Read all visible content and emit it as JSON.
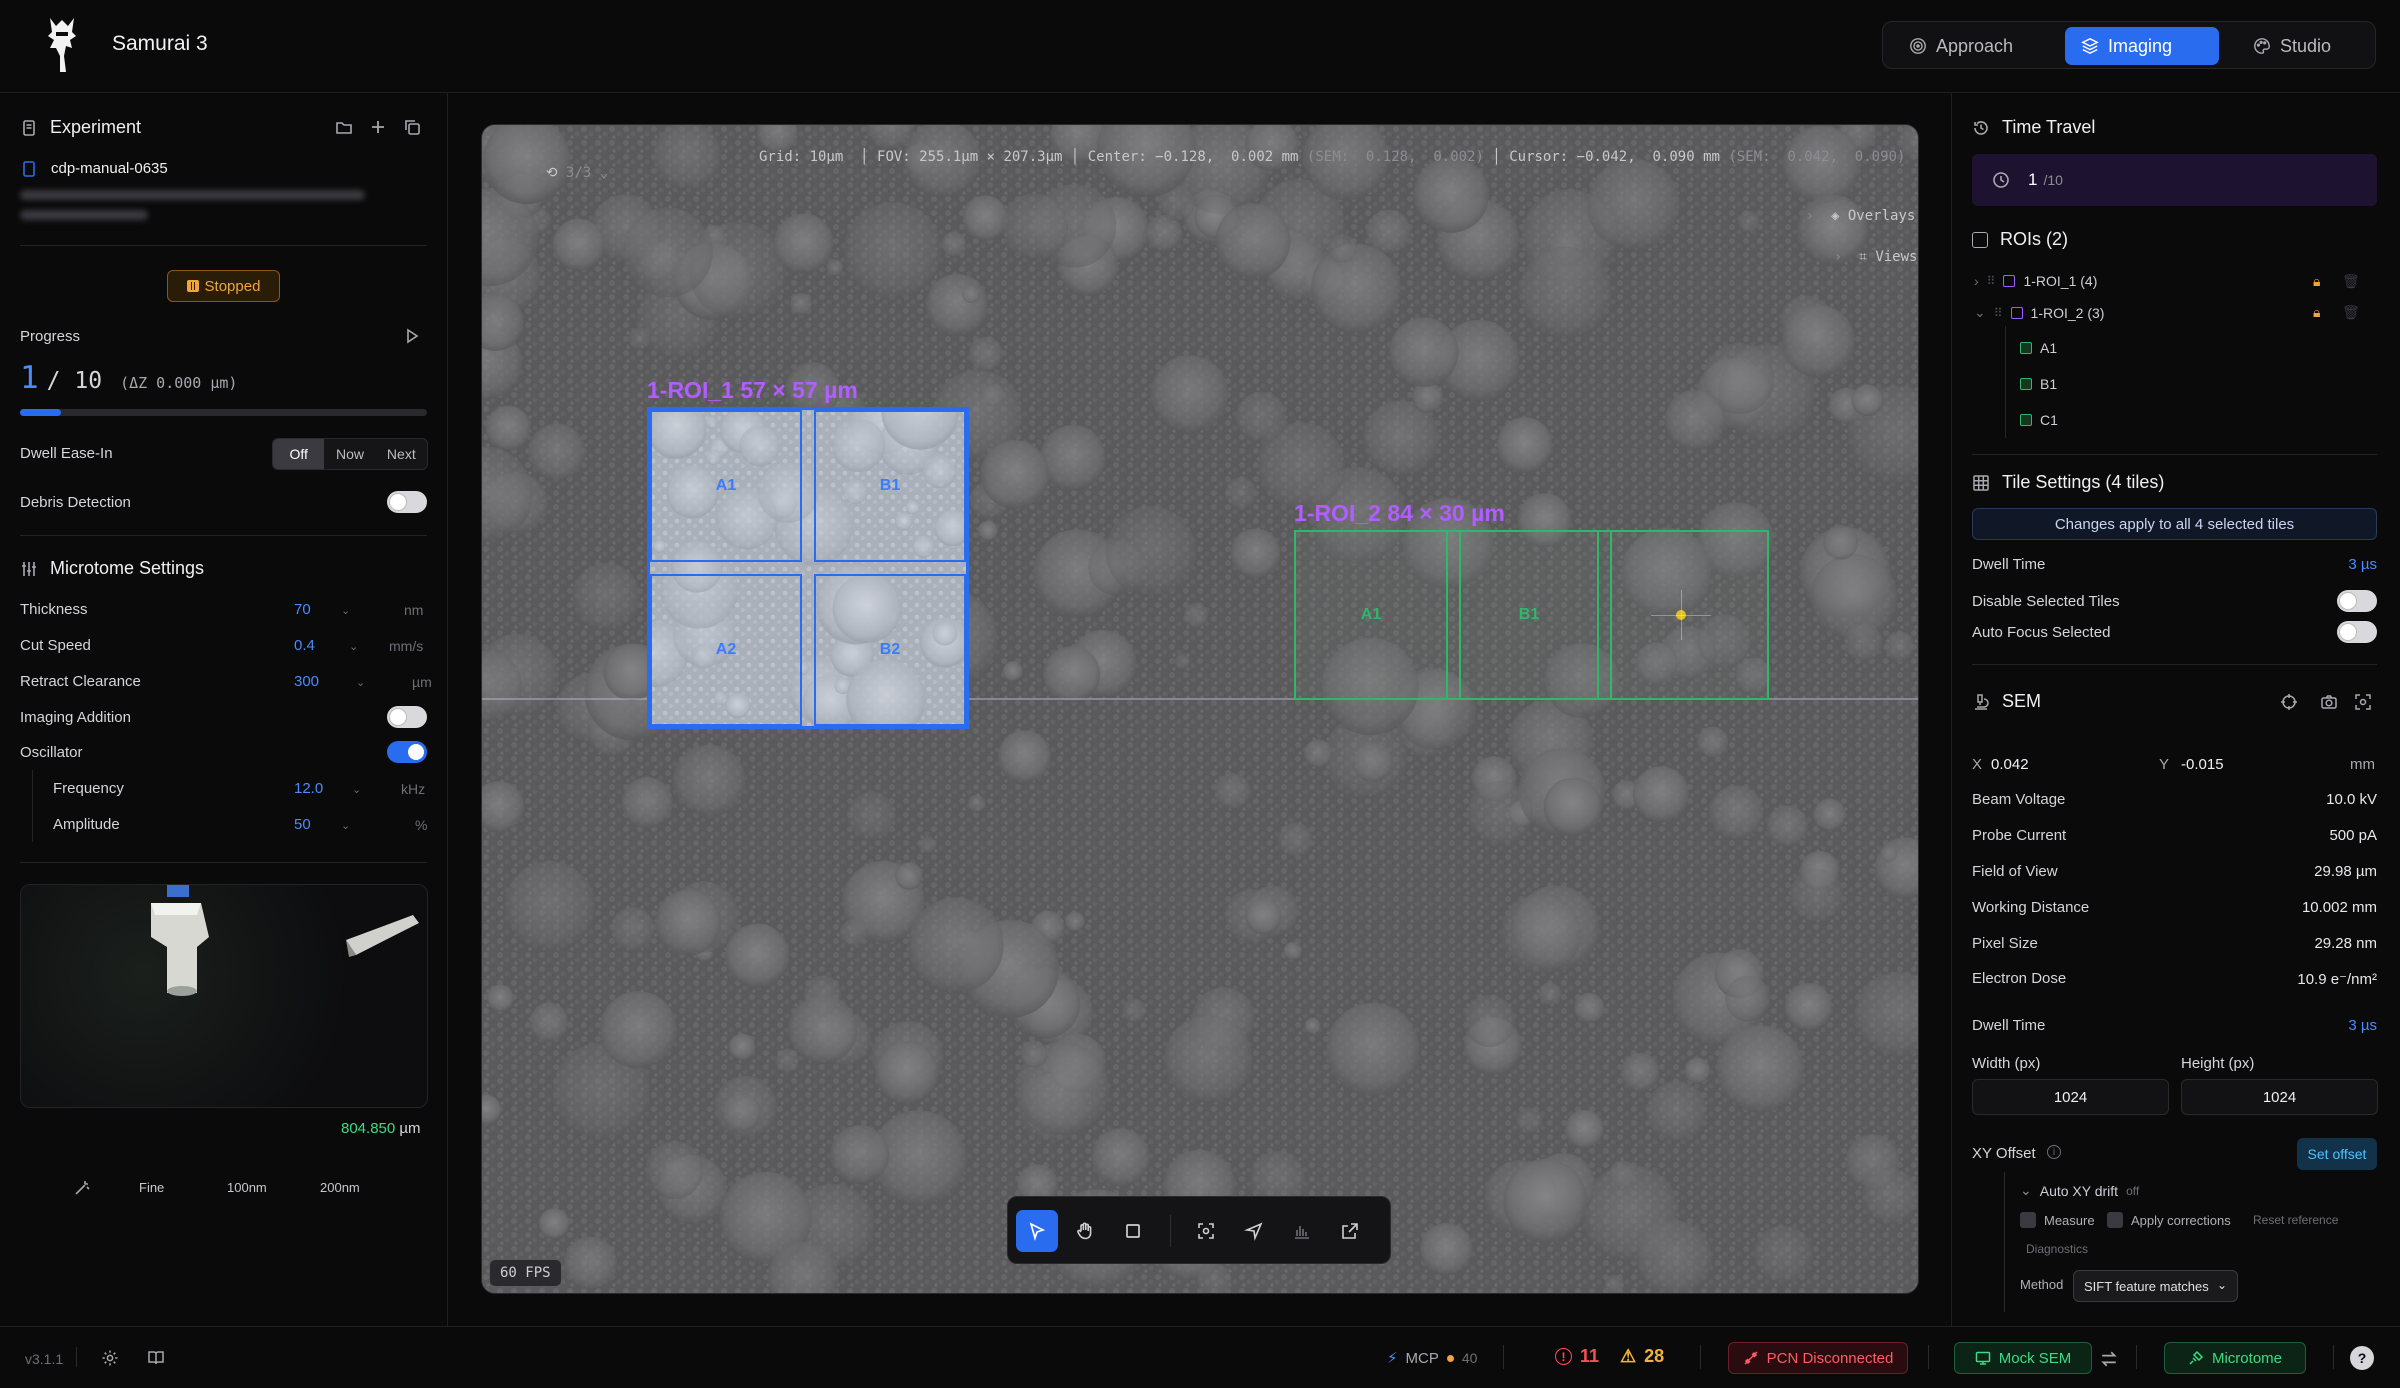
{
  "app": {
    "title": "Samurai 3"
  },
  "modes": [
    {
      "label": "Approach",
      "icon": "target-icon",
      "active": false
    },
    {
      "label": "Imaging",
      "icon": "layers-icon",
      "active": true
    },
    {
      "label": "Studio",
      "icon": "palette-icon",
      "active": false
    }
  ],
  "experiment": {
    "title": "Experiment",
    "name": "cdp-manual-0635",
    "status": "Stopped",
    "progress_label": "Progress",
    "progress_current": "1",
    "progress_total": "/ 10",
    "progress_delta": "(ΔZ 0.000 µm)",
    "progress_fraction": 0.1,
    "dwell_ease_label": "Dwell Ease-In",
    "dwell_ease_options": [
      "Off",
      "Now",
      "Next"
    ],
    "dwell_ease_selected": "Off",
    "debris_label": "Debris Detection",
    "debris_on": false
  },
  "microtome": {
    "title": "Microtome Settings",
    "thickness": {
      "label": "Thickness",
      "value": "70",
      "unit": "nm"
    },
    "cut_speed": {
      "label": "Cut Speed",
      "value": "0.4",
      "unit": "mm/s"
    },
    "retract": {
      "label": "Retract Clearance",
      "value": "300",
      "unit": "µm"
    },
    "imaging_addition": {
      "label": "Imaging Addition",
      "on": false
    },
    "oscillator": {
      "label": "Oscillator",
      "on": true
    },
    "frequency": {
      "label": "Frequency",
      "value": "12.0",
      "unit": "kHz"
    },
    "amplitude": {
      "label": "Amplitude",
      "value": "50",
      "unit": "%"
    },
    "position": "804.850",
    "position_unit": "µm",
    "step_options": [
      "Fine",
      "100nm",
      "200nm"
    ]
  },
  "viewer": {
    "counter": "3/3",
    "grid": "Grid: 10µm",
    "fov": "FOV: 255.1µm × 207.3µm",
    "center": "Center: −0.128,  0.002 mm",
    "center_sem": "(SEM:  0.128,  0.002)",
    "cursor": "Cursor: −0.042,  0.090 mm",
    "cursor_sem": "(SEM:  0.042,  0.090)",
    "overlays": "Overlays",
    "views": "Views",
    "fps": "60 FPS",
    "roi1_label": "1-ROI_1 57 × 57 µm",
    "roi2_label": "1-ROI_2 84 × 30 µm",
    "roi1_tiles": [
      "A1",
      "B1",
      "A2",
      "B2"
    ],
    "roi2_tiles": [
      "A1",
      "B1"
    ],
    "accent_blue": "#2a6cf0",
    "accent_green": "#2fb86a",
    "accent_purple": "#b35cff"
  },
  "toolbar": {
    "tools": [
      "select-pointer-icon",
      "hand-pan-icon",
      "rectangle-icon",
      "focus-icon",
      "navigate-icon",
      "histogram-icon",
      "external-link-icon"
    ]
  },
  "time_travel": {
    "title": "Time Travel",
    "current": "1",
    "total": "/10"
  },
  "rois": {
    "title": "ROIs (2)",
    "items": [
      {
        "label": "1-ROI_1 (4)",
        "expanded": false
      },
      {
        "label": "1-ROI_2 (3)",
        "expanded": true
      }
    ],
    "children": [
      "A1",
      "B1",
      "C1"
    ]
  },
  "tile_settings": {
    "title": "Tile Settings (4 tiles)",
    "info": "Changes apply to all 4 selected tiles",
    "dwell_label": "Dwell Time",
    "dwell_value": "3 µs",
    "disable_label": "Disable Selected Tiles",
    "autofocus_label": "Auto Focus Selected"
  },
  "sem": {
    "title": "SEM",
    "x_label": "X",
    "x_value": "0.042",
    "y_label": "Y",
    "y_value": "-0.015",
    "xy_unit": "mm",
    "rows": [
      {
        "label": "Beam Voltage",
        "value": "10.0 kV"
      },
      {
        "label": "Probe Current",
        "value": "500 pA"
      },
      {
        "label": "Field of View",
        "value": "29.98 µm"
      },
      {
        "label": "Working Distance",
        "value": "10.002 mm"
      },
      {
        "label": "Pixel Size",
        "value": "29.28 nm"
      },
      {
        "label": "Electron Dose",
        "value": "10.9 e⁻/nm²"
      }
    ],
    "dwell_label": "Dwell Time",
    "dwell_value": "3 µs",
    "width_label": "Width (px)",
    "width_value": "1024",
    "height_label": "Height (px)",
    "height_value": "1024",
    "xy_offset_label": "XY Offset",
    "set_offset": "Set offset",
    "auto_drift": "Auto XY drift",
    "auto_drift_state": "off",
    "measure": "Measure",
    "apply_corrections": "Apply corrections",
    "reset_reference": "Reset reference",
    "diagnostics": "Diagnostics",
    "method_label": "Method",
    "method_value": "SIFT feature matches"
  },
  "statusbar": {
    "version": "v3.1.1",
    "mcp": "MCP",
    "mcp_count": "40",
    "errors": "11",
    "warnings": "28",
    "pcn": "PCN Disconnected",
    "mock_sem": "Mock SEM",
    "microtome": "Microtome",
    "help": "?"
  }
}
